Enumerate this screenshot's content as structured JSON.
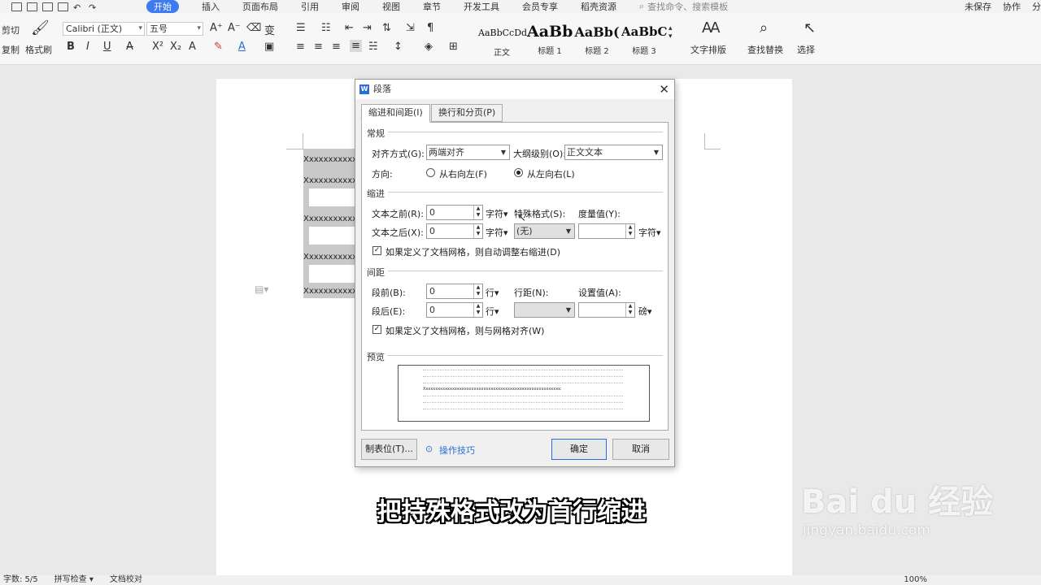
{
  "menubar": {
    "tabs": [
      "开始",
      "插入",
      "页面布局",
      "引用",
      "审阅",
      "视图",
      "章节",
      "开发工具",
      "会员专享",
      "稻壳资源"
    ],
    "active_tab": "开始",
    "search_placeholder": "查找命令、搜索模板",
    "unsaved": "未保存",
    "collab": "协作",
    "share": "分"
  },
  "ribbon": {
    "cut": "剪切",
    "copy": "复制",
    "format_painter": "格式刷",
    "font_name": "Calibri (正文)",
    "font_size": "五号",
    "styles": [
      {
        "sample": "AaBbCcDd",
        "label": "正文"
      },
      {
        "sample": "AaBb",
        "label": "标题 1"
      },
      {
        "sample": "AaBb(",
        "label": "标题 2"
      },
      {
        "sample": "AaBbC",
        "label": "标题 3"
      }
    ],
    "text_layout": "文字排版",
    "find_replace": "查找替换",
    "select": "选择"
  },
  "document": {
    "lines": [
      "Xxxxxxxxxxxx",
      "Xxxxxxxxxxxx",
      "Xxxxxxxxxxxx",
      "Xxxxxxxxxxxx",
      "Xxxxxxxxxxxx"
    ]
  },
  "dialog": {
    "title": "段落",
    "tabs": [
      "缩进和间距(I)",
      "换行和分页(P)"
    ],
    "general": {
      "section": "常规",
      "align_label": "对齐方式(G):",
      "align_value": "两端对齐",
      "outline_label": "大纲级别(O):",
      "outline_value": "正文文本",
      "direction_label": "方向:",
      "rtl": "从右向左(F)",
      "ltr": "从左向右(L)"
    },
    "indent": {
      "section": "缩进",
      "before_label": "文本之前(R):",
      "before_value": "0",
      "after_label": "文本之后(X):",
      "after_value": "0",
      "unit": "字符▾",
      "special_label": "特殊格式(S):",
      "special_value": "(无)",
      "measure_label": "度量值(Y):",
      "measure_unit": "字符▾",
      "auto_adjust": "如果定义了文档网格，则自动调整右缩进(D)"
    },
    "spacing": {
      "section": "间距",
      "before_label": "段前(B):",
      "before_value": "0",
      "after_label": "段后(E):",
      "after_value": "0",
      "unit": "行▾",
      "line_label": "行距(N):",
      "setting_label": "设置值(A):",
      "setting_unit": "磅▾",
      "grid_align": "如果定义了文档网格，则与网格对齐(W)"
    },
    "preview_label": "预览",
    "preview_sample": "Xxxxxxxxxxxxxxxxxxxxxxxxxxxxxxxxxxxxxxxxxxxxxxxxxxxxxxxxxx",
    "tabs_button": "制表位(T)...",
    "tips": "操作技巧",
    "ok": "确定",
    "cancel": "取消"
  },
  "statusbar": {
    "word_count": "字数: 5/5",
    "spell_check": "拼写检查 ▾",
    "doc_check": "文档校对",
    "zoom": "100%"
  },
  "overlay": {
    "subtitle": "把持殊格式改为首行缩进",
    "watermark_brand": "Bai du 经验",
    "watermark_url": "jingyan.baidu.com"
  },
  "colors": {
    "accent": "#3d7bf0",
    "dialog_bg": "#f0f0f0",
    "selection": "#c9c9c9"
  }
}
